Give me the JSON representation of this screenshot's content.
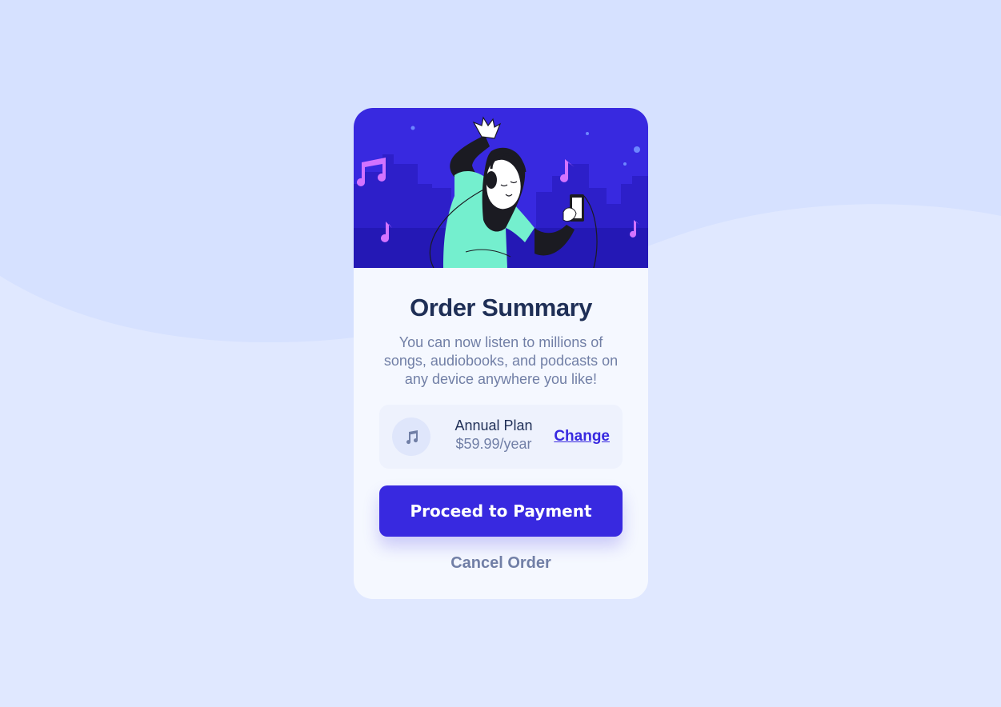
{
  "colors": {
    "page_background": "#e0e8ff",
    "wave": "#d6e1ff",
    "card_background": "#f5f8ff",
    "hero_background": "#3829e0",
    "primary": "#3829e0",
    "heading": "#1f2f56",
    "muted_text": "#717fa6",
    "plan_box": "#eef2fd"
  },
  "card": {
    "title": "Order Summary",
    "description": "You can now listen to millions of songs, audiobooks, and podcasts on any device anywhere you like!",
    "hero_illustration": "person-dancing-with-headphones-illustration"
  },
  "plan": {
    "icon": "music-note-icon",
    "name": "Annual Plan",
    "price": "$59.99/year",
    "change_label": "Change"
  },
  "actions": {
    "proceed_label": "Proceed to Payment",
    "cancel_label": "Cancel Order"
  }
}
